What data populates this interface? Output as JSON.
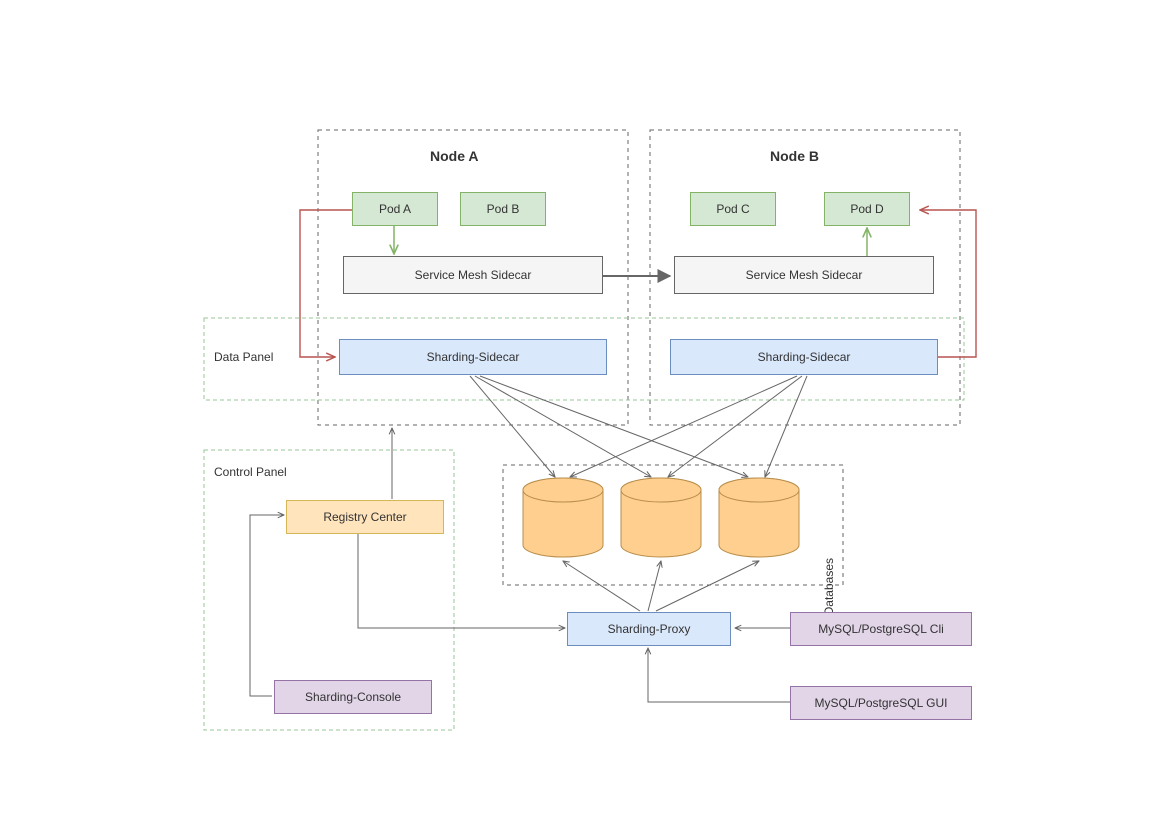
{
  "nodes": {
    "a": {
      "title": "Node A",
      "pods": [
        "Pod A",
        "Pod B"
      ],
      "mesh": "Service Mesh Sidecar",
      "sidecar": "Sharding-Sidecar"
    },
    "b": {
      "title": "Node B",
      "pods": [
        "Pod C",
        "Pod D"
      ],
      "mesh": "Service Mesh Sidecar",
      "sidecar": "Sharding-Sidecar"
    }
  },
  "panels": {
    "data": "Data Panel",
    "control": "Control Panel",
    "databases": "Databases"
  },
  "components": {
    "registry": "Registry Center",
    "console": "Sharding-Console",
    "proxy": "Sharding-Proxy",
    "cli": "MySQL/PostgreSQL Cli",
    "gui": "MySQL/PostgreSQL GUI"
  },
  "colors": {
    "pod_fill": "#d5e8d4",
    "pod_border": "#82b366",
    "blue_fill": "#dae8fc",
    "blue_border": "#6c8ebf",
    "orange_fill": "#ffe4bc",
    "orange_border": "#d6b656",
    "purple_fill": "#e1d5e7",
    "purple_border": "#9673a6",
    "db_fill": "#ffcf8f",
    "db_border": "#b98e4b",
    "red": "#b85450",
    "green": "#82b366",
    "grey": "#666666",
    "panel_green": "#97c796"
  }
}
